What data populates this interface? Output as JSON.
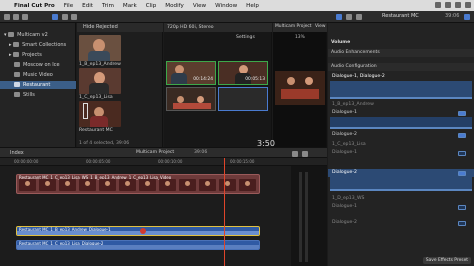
{
  "menubar": {
    "apple": "",
    "items": [
      "Final Cut Pro",
      "File",
      "Edit",
      "Trim",
      "Mark",
      "Clip",
      "Modify",
      "View",
      "Window",
      "Help"
    ]
  },
  "toolbar": {
    "center_label": "Restaurant MC"
  },
  "sidebar": {
    "items": [
      {
        "label": "Multicam v2",
        "selected": false,
        "indent": 0
      },
      {
        "label": "Smart Collections",
        "selected": false,
        "indent": 1
      },
      {
        "label": "Projects",
        "selected": false,
        "indent": 1
      },
      {
        "label": "Moscow on Ice",
        "selected": false,
        "indent": 1
      },
      {
        "label": "Music Video",
        "selected": false,
        "indent": 1
      },
      {
        "label": "Restaurant",
        "selected": true,
        "indent": 1
      },
      {
        "label": "Stills",
        "selected": false,
        "indent": 1
      }
    ]
  },
  "browser": {
    "header": "Hide Rejected",
    "clips": [
      "1_B_ep13_Andrew",
      "1_C_ep13_Lisa",
      "Restaurant MC"
    ],
    "selection_status": "1 of 4 selected, 39:06"
  },
  "angle_viewer": {
    "header": "720p HD 60i, Stereo",
    "settings_label": "Settings",
    "angle_times": [
      "00:14:24",
      "00:05:13"
    ]
  },
  "viewer": {
    "project": "Multicam Project",
    "zoom": "13%",
    "view_label": "View",
    "timecode": "3:50"
  },
  "inspector": {
    "title": "Restaurant MC",
    "duration": "39:06",
    "section_volume": "Volume",
    "section_enhancements": "Audio Enhancements",
    "section_config": "Audio Configuration",
    "top_label": "Dialogue-1, Dialogue-2",
    "groups": [
      {
        "name": "1_B_ep13_Andrew",
        "lanes": [
          "Dialogue-1",
          "Dialogue-2"
        ],
        "enabled": [
          true,
          true
        ]
      },
      {
        "name": "1_C_ep13_Lisa",
        "lanes": [
          "Dialogue-1",
          "Dialogue-2"
        ],
        "enabled": [
          false,
          true
        ]
      },
      {
        "name": "1_D_ep13_WS",
        "lanes": [
          "Dialogue-1",
          "Dialogue-2"
        ],
        "enabled": [
          false,
          false
        ]
      }
    ],
    "footer_button": "Save Effects Preset"
  },
  "timeline": {
    "index_label": "Index",
    "project_label": "Multicam Project",
    "project_duration": "39:06",
    "ruler_ticks": [
      "00:00:00:00",
      "00:00:05:00",
      "00:00:10:00",
      "00:00:15:00"
    ],
    "video_clip": "Restaurant MC_1_C_ep13_Lisa_WS_1_B_ep13_Andrew_1_C_ep13_Lisa_Video",
    "audio_clip_1": "Restaurant MC_1_B_ep13_Andrew_Dialogue-1",
    "audio_clip_2": "Restaurant MC_1_C_ep13_Lisa_Dialogue-2"
  },
  "colors": {
    "selection": "#3b5e88",
    "angle_active": "#3da84a",
    "video_clip": "#6e3a3a",
    "audio_clip": "#2f5aa4",
    "playhead": "#e0452a"
  }
}
